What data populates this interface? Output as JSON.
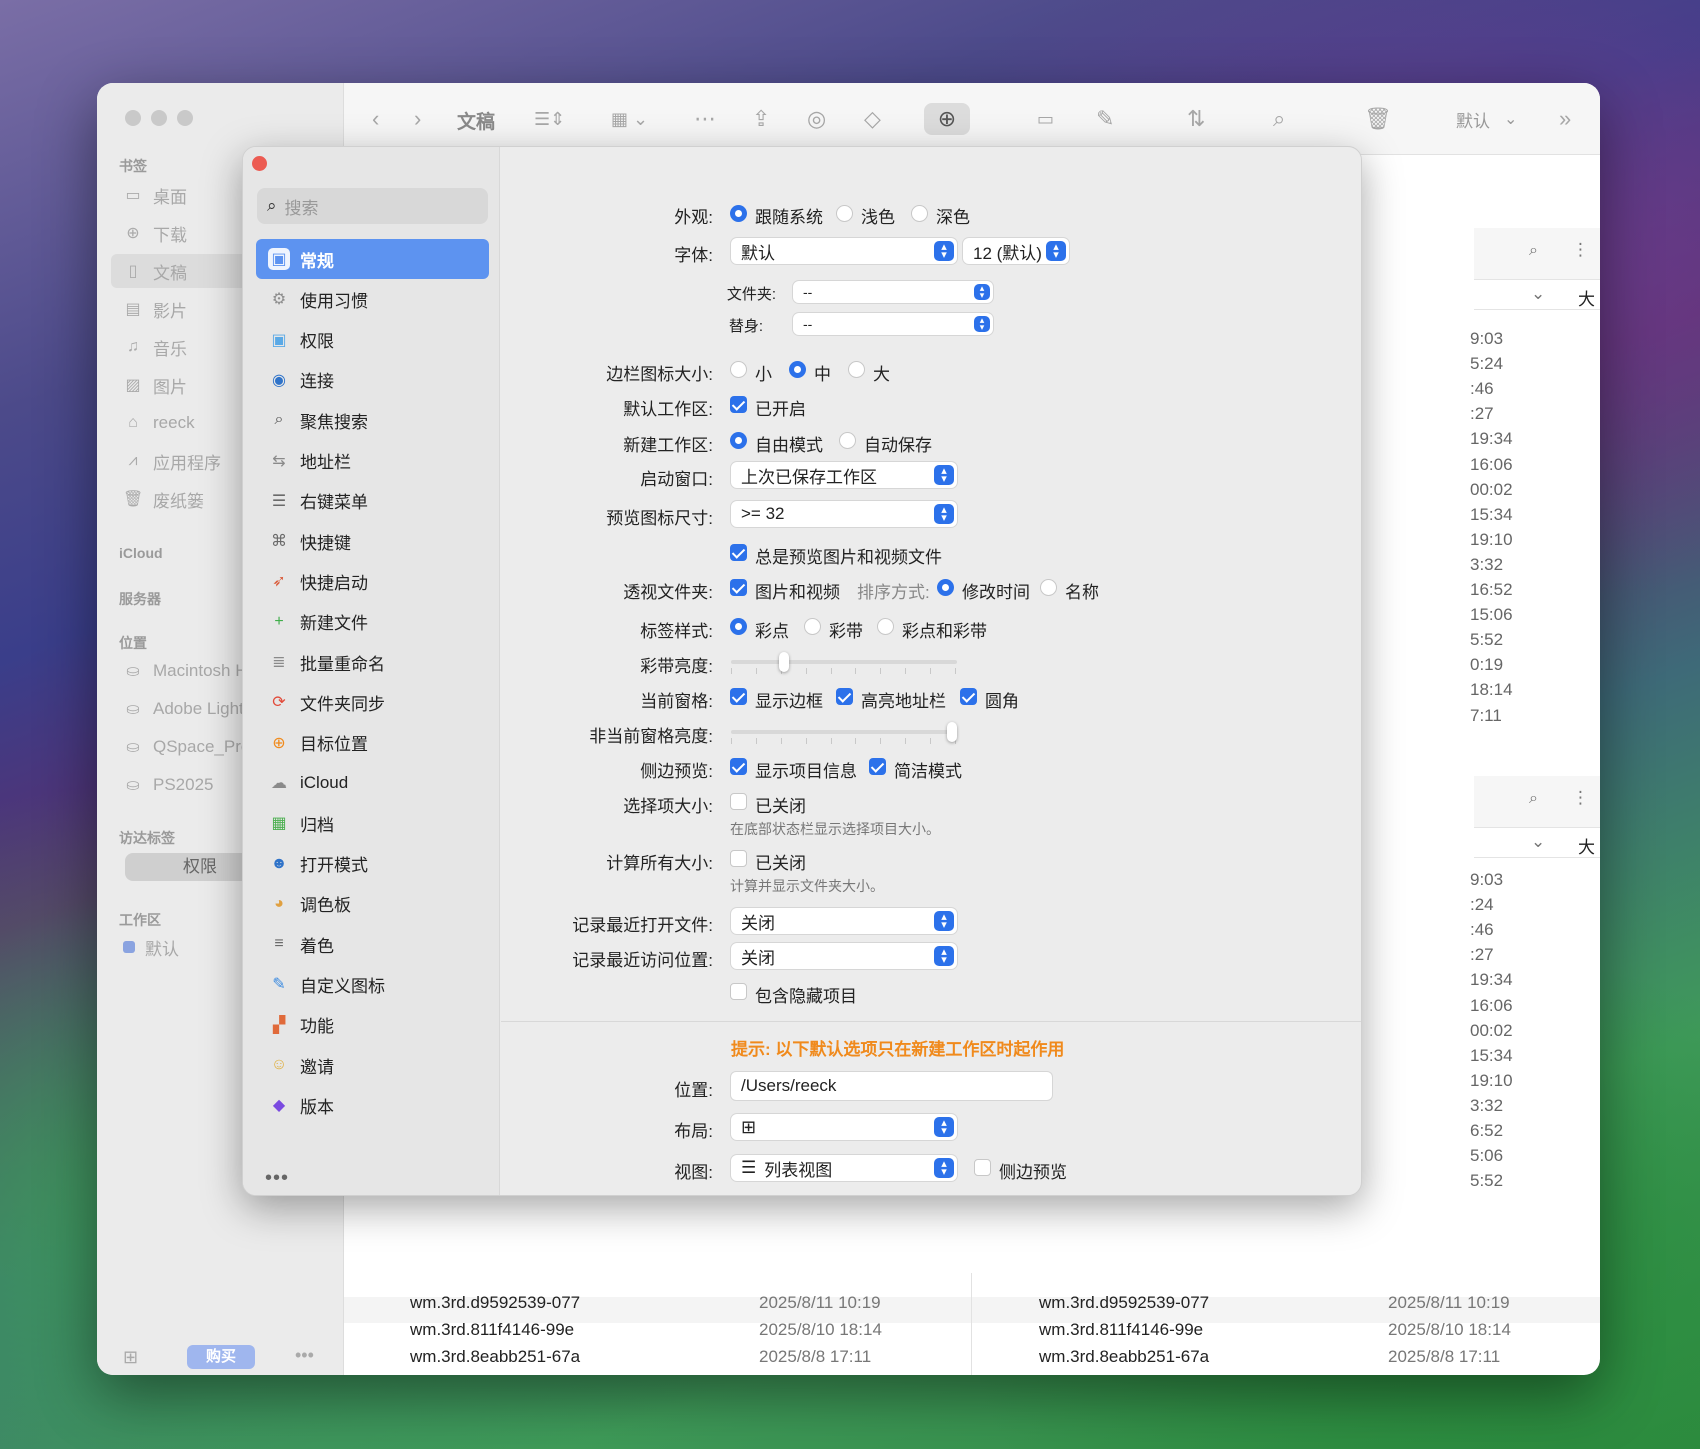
{
  "finder": {
    "toolbar_title": "文稿",
    "toolbar_default": "默认",
    "sidebar": {
      "bookmarks_title": "书签",
      "bookmarks": [
        {
          "label": "桌面",
          "icon": "desktop-icon"
        },
        {
          "label": "下载",
          "icon": "download-icon"
        },
        {
          "label": "文稿",
          "icon": "document-icon"
        },
        {
          "label": "影片",
          "icon": "film-icon"
        },
        {
          "label": "音乐",
          "icon": "music-icon"
        },
        {
          "label": "图片",
          "icon": "photo-icon"
        },
        {
          "label": "reeck",
          "icon": "home-icon"
        },
        {
          "label": "应用程序",
          "icon": "applications-icon"
        },
        {
          "label": "废纸篓",
          "icon": "trash-icon"
        }
      ],
      "icloud_title": "iCloud",
      "servers_title": "服务器",
      "locations_title": "位置",
      "locations": [
        "Macintosh HD",
        "Adobe Lightr",
        "QSpace_Pro_",
        "PS2025"
      ],
      "tags_title": "访达标签",
      "tag_pill": "权限",
      "workspace_title": "工作区",
      "workspace_item": "默认",
      "buy_label": "购买"
    },
    "files": [
      {
        "name": "wm.3rd.d9592539-077",
        "date": "2025/8/11 10:19"
      },
      {
        "name": "wm.3rd.811f4146-99e",
        "date": "2025/8/10 18:14"
      },
      {
        "name": "wm.3rd.8eabb251-67a",
        "date": "2025/8/8 17:11"
      }
    ],
    "right_times_top": [
      "9:03",
      "5:24",
      ":46",
      ":27",
      "19:34",
      "16:06",
      "00:02",
      "15:34",
      "19:10",
      "3:32",
      "16:52",
      "15:06",
      "5:52",
      "0:19",
      "18:14",
      "7:11"
    ],
    "right_times_bottom": [
      "9:03",
      ":24",
      ":46",
      ":27",
      "19:34",
      "16:06",
      "00:02",
      "15:34",
      "19:10",
      "3:32",
      "6:52",
      "5:06",
      "5:52"
    ],
    "right_header_size": "大"
  },
  "prefs": {
    "search_placeholder": "搜索",
    "nav": [
      {
        "label": "常规",
        "icon": "general-icon",
        "color": "#ffffff"
      },
      {
        "label": "使用习惯",
        "icon": "gear-icon",
        "color": "#8e8e8e"
      },
      {
        "label": "权限",
        "icon": "folder-check-icon",
        "color": "#5aa9e6"
      },
      {
        "label": "连接",
        "icon": "globe-icon",
        "color": "#2f73c9"
      },
      {
        "label": "聚焦搜索",
        "icon": "magnifier-icon",
        "color": "#555555"
      },
      {
        "label": "地址栏",
        "icon": "address-bar-icon",
        "color": "#8a8a8a"
      },
      {
        "label": "右键菜单",
        "icon": "context-menu-icon",
        "color": "#6a6a6a"
      },
      {
        "label": "快捷键",
        "icon": "command-key-icon",
        "color": "#6a6a6a"
      },
      {
        "label": "快捷启动",
        "icon": "rocket-icon",
        "color": "#d95b3a"
      },
      {
        "label": "新建文件",
        "icon": "new-file-icon",
        "color": "#3fae4a"
      },
      {
        "label": "批量重命名",
        "icon": "batch-rename-icon",
        "color": "#8a8a8a"
      },
      {
        "label": "文件夹同步",
        "icon": "sync-icon",
        "color": "#e24b3a"
      },
      {
        "label": "目标位置",
        "icon": "target-icon",
        "color": "#f08a1c"
      },
      {
        "label": "iCloud",
        "icon": "cloud-icon",
        "color": "#8a8a8a"
      },
      {
        "label": "归档",
        "icon": "archive-icon",
        "color": "#4caf50"
      },
      {
        "label": "打开模式",
        "icon": "finder-icon",
        "color": "#2f73c9"
      },
      {
        "label": "调色板",
        "icon": "palette-icon",
        "color": "#e0a040"
      },
      {
        "label": "着色",
        "icon": "list-color-icon",
        "color": "#6a6a6a"
      },
      {
        "label": "自定义图标",
        "icon": "custom-icon-icon",
        "color": "#3a8ae0"
      },
      {
        "label": "功能",
        "icon": "features-icon",
        "color": "#e06a3a"
      },
      {
        "label": "邀请",
        "icon": "invite-icon",
        "color": "#e0b040"
      },
      {
        "label": "版本",
        "icon": "layers-icon",
        "color": "#7a4ae0"
      }
    ],
    "more": "•••",
    "appearance": {
      "label": "外观:",
      "options": [
        "跟随系统",
        "浅色",
        "深色"
      ]
    },
    "font": {
      "label": "字体:",
      "value": "默认",
      "size": "12 (默认)"
    },
    "folder": {
      "label": "文件夹:",
      "value": "--"
    },
    "alias": {
      "label": "替身:",
      "value": "--"
    },
    "sidebar_icon_size": {
      "label": "边栏图标大小:",
      "options": [
        "小",
        "中",
        "大"
      ]
    },
    "default_workspace": {
      "label": "默认工作区:",
      "value": "已开启"
    },
    "new_workspace": {
      "label": "新建工作区:",
      "options": [
        "自由模式",
        "自动保存"
      ]
    },
    "startup_window": {
      "label": "启动窗口:",
      "value": "上次已保存工作区"
    },
    "preview_icon_size": {
      "label": "预览图标尺寸:",
      "value": ">= 32"
    },
    "always_preview": "总是预览图片和视频文件",
    "perspective": {
      "label": "透视文件夹:",
      "value": "图片和视频",
      "sort_label": "排序方式:",
      "options": [
        "修改时间",
        "名称"
      ]
    },
    "tag_style": {
      "label": "标签样式:",
      "options": [
        "彩点",
        "彩带",
        "彩点和彩带"
      ]
    },
    "ribbon_brightness": {
      "label": "彩带亮度:",
      "level": 0.22
    },
    "current_pane": {
      "label": "当前窗格:",
      "options": [
        "显示边框",
        "高亮地址栏",
        "圆角"
      ]
    },
    "inactive_brightness": {
      "label": "非当前窗格亮度:",
      "level": 1.0
    },
    "side_preview": {
      "label": "侧边预览:",
      "options": [
        "显示项目信息",
        "简洁模式"
      ]
    },
    "selection_size": {
      "label": "选择项大小:",
      "value": "已关闭",
      "hint": "在底部状态栏显示选择项目大小。"
    },
    "calc_all_sizes": {
      "label": "计算所有大小:",
      "value": "已关闭",
      "hint": "计算并显示文件夹大小。"
    },
    "recent_files": {
      "label": "记录最近打开文件:",
      "value": "关闭"
    },
    "recent_locations": {
      "label": "记录最近访问位置:",
      "value": "关闭"
    },
    "include_hidden": "包含隐藏项目",
    "tip": "提示: 以下默认选项只在新建工作区时起作用",
    "location": {
      "label": "位置:",
      "value": "/Users/reeck"
    },
    "layout": {
      "label": "布局:"
    },
    "view": {
      "label": "视图:",
      "value": "列表视图",
      "side_preview": "侧边预览"
    },
    "accent": "#2c71ea"
  }
}
